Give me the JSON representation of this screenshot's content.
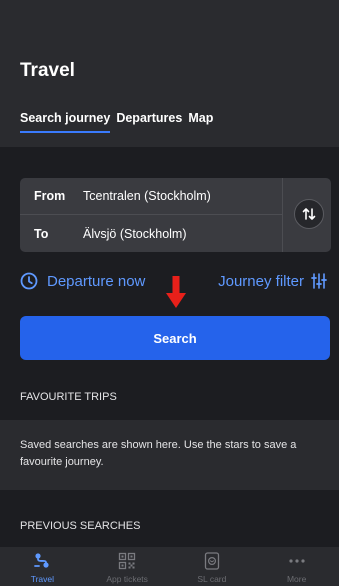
{
  "header": {
    "title": "Travel",
    "tabs": [
      {
        "label": "Search journey",
        "active": true
      },
      {
        "label": "Departures",
        "active": false
      },
      {
        "label": "Map",
        "active": false
      }
    ]
  },
  "route": {
    "from_label": "From",
    "from_value": "Tcentralen (Stockholm)",
    "to_label": "To",
    "to_value": "Älvsjö (Stockholm)",
    "swap_icon": "swap-vertical-icon"
  },
  "options": {
    "departure_label": "Departure now",
    "departure_icon": "clock-icon",
    "filter_label": "Journey filter",
    "filter_icon": "sliders-icon"
  },
  "search_button": {
    "label": "Search"
  },
  "favourites": {
    "heading": "FAVOURITE TRIPS",
    "empty_text": "Saved searches are shown here. Use the stars to save a favourite journey."
  },
  "previous": {
    "heading": "PREVIOUS SEARCHES"
  },
  "bottom_nav": [
    {
      "label": "Travel",
      "icon": "travel-icon",
      "active": true
    },
    {
      "label": "App tickets",
      "icon": "qr-code-icon",
      "active": false
    },
    {
      "label": "SL card",
      "icon": "sl-card-icon",
      "active": false
    },
    {
      "label": "More",
      "icon": "more-dots-icon",
      "active": false
    }
  ],
  "colors": {
    "background": "#1c1d21",
    "surface": "#2a2b2f",
    "accent": "#2563eb",
    "link": "#5f99ff",
    "annotation_arrow": "#e8201a"
  }
}
